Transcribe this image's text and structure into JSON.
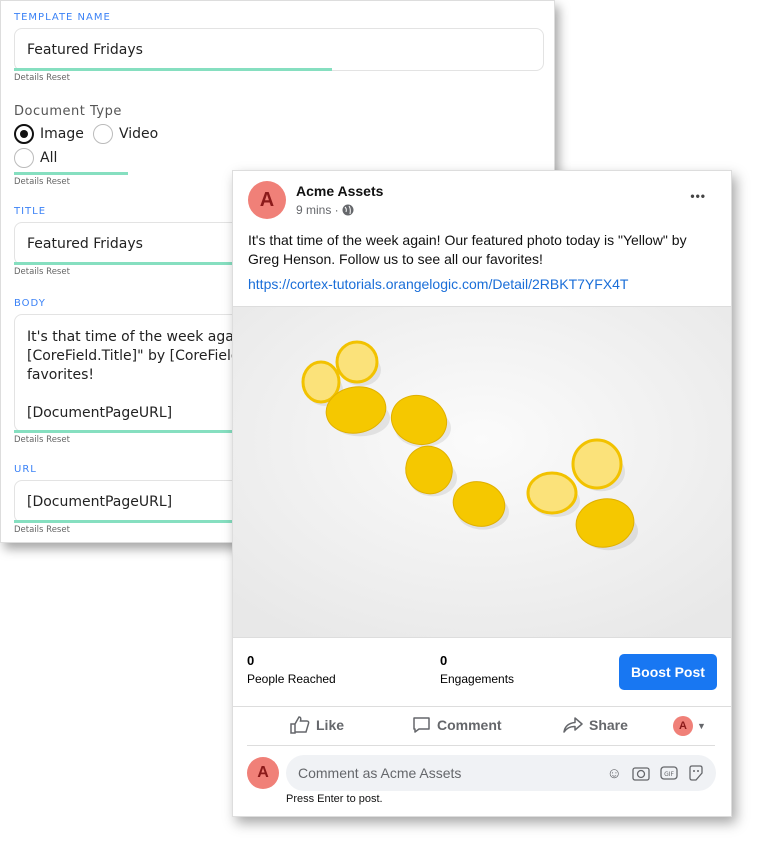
{
  "form": {
    "template_name_label": "TEMPLATE NAME",
    "template_name_value": "Featured Fridays",
    "details_reset": "Details Reset",
    "doc_type_label": "Document Type",
    "doc_types": [
      {
        "label": "Image",
        "selected": true
      },
      {
        "label": "Video",
        "selected": false
      },
      {
        "label": "All",
        "selected": false
      }
    ],
    "title_label": "TITLE",
    "title_value": "Featured Fridays",
    "body_label": "BODY",
    "body_lines": [
      "It's that time of the week again! Our featured photo today is \"",
      "[CoreField.Title]\" by [CoreField.Photographer]. Follow us to see all our",
      "favorites!",
      "",
      "[DocumentPageURL]"
    ],
    "url_label": "URL",
    "url_value": "[DocumentPageURL]",
    "accent": "#3b82f6",
    "bar_color": "#86dfc0"
  },
  "post": {
    "avatar_letter": "A",
    "page_name": "Acme Assets",
    "time": "9 mins ·",
    "globe_icon": "globe-icon",
    "more_icon": "•••",
    "text": "It's that time of the week again! Our featured photo today is \"Yellow\" by Greg Henson. Follow us to see all our favorites!",
    "link": "https://cortex-tutorials.orangelogic.com/Detail/2RBKT7YFX4T",
    "people_reached": "0",
    "people_reached_label": "People Reached",
    "engagements": "0",
    "engagements_label": "Engagements",
    "boost_label": "Boost Post",
    "boost_color": "#1877f2",
    "like": "Like",
    "comment": "Comment",
    "share": "Share",
    "comment_placeholder": "Comment as Acme Assets",
    "hint": "Press Enter to post."
  }
}
